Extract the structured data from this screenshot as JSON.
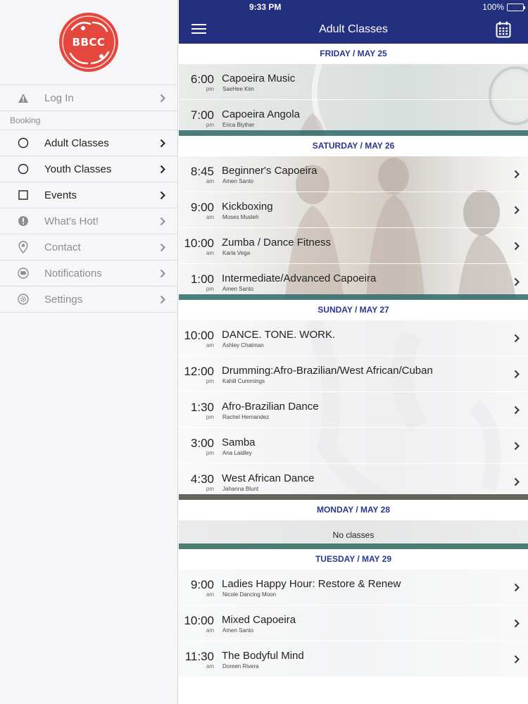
{
  "status_bar": {
    "time": "9:33 PM",
    "battery": "100%"
  },
  "nav": {
    "title": "Adult Classes"
  },
  "logo": {
    "text": "BBCC"
  },
  "sidebar": {
    "login": {
      "label": "Log In"
    },
    "section_label": "Booking",
    "items": [
      {
        "label": "Adult Classes"
      },
      {
        "label": "Youth Classes"
      },
      {
        "label": "Events"
      },
      {
        "label": "What's Hot!"
      },
      {
        "label": "Contact"
      },
      {
        "label": "Notifications"
      },
      {
        "label": "Settings"
      }
    ]
  },
  "days": [
    {
      "header": "FRIDAY / MAY 25",
      "classes": [
        {
          "time": "6:00",
          "ampm": "pm",
          "name": "Capoeira Music",
          "instructor": "SaeHee Kim"
        },
        {
          "time": "7:00",
          "ampm": "pm",
          "name": "Capoeira Angola",
          "instructor": "Erica Blyther"
        }
      ]
    },
    {
      "header": "SATURDAY / MAY 26",
      "classes": [
        {
          "time": "8:45",
          "ampm": "am",
          "name": "Beginner's Capoeira",
          "instructor": "Amen Santo"
        },
        {
          "time": "9:00",
          "ampm": "am",
          "name": "Kickboxing",
          "instructor": "Moses Musleh"
        },
        {
          "time": "10:00",
          "ampm": "am",
          "name": "Zumba / Dance Fitness",
          "instructor": "Karla Vega"
        },
        {
          "time": "1:00",
          "ampm": "pm",
          "name": "Intermediate/Advanced Capoeira",
          "instructor": "Amen Santo"
        }
      ]
    },
    {
      "header": "SUNDAY / MAY 27",
      "classes": [
        {
          "time": "10:00",
          "ampm": "am",
          "name": "DANCE. TONE. WORK.",
          "instructor": "Ashley Chatman"
        },
        {
          "time": "12:00",
          "ampm": "pm",
          "name": "Drumming:Afro-Brazilian/West African/Cuban",
          "instructor": "Kahill Cummings"
        },
        {
          "time": "1:30",
          "ampm": "pm",
          "name": "Afro-Brazilian Dance",
          "instructor": "Rachel Hernandez"
        },
        {
          "time": "3:00",
          "ampm": "pm",
          "name": "Samba",
          "instructor": "Ana Laidley"
        },
        {
          "time": "4:30",
          "ampm": "pm",
          "name": "West African Dance",
          "instructor": "Jahanna Blunt"
        }
      ]
    },
    {
      "header": "MONDAY / MAY 28",
      "no_classes": "No classes"
    },
    {
      "header": "TUESDAY / MAY 29",
      "classes": [
        {
          "time": "9:00",
          "ampm": "am",
          "name": "Ladies Happy Hour: Restore & Renew",
          "instructor": "Nicole Dancing Moon"
        },
        {
          "time": "10:00",
          "ampm": "am",
          "name": "Mixed Capoeira",
          "instructor": "Amen Santo"
        },
        {
          "time": "11:30",
          "ampm": "am",
          "name": "The Bodyful Mind",
          "instructor": "Doreen Rivera"
        }
      ]
    }
  ],
  "colors": {
    "nav_bar": "#23307f",
    "day_header_text": "#2a3791",
    "logo": "#e4473d"
  },
  "icons": {
    "menu": "hamburger-icon",
    "calendar": "calendar-icon",
    "login": "warning-icon",
    "adult": "circle-icon",
    "youth": "circle-icon",
    "events": "square-icon",
    "hot": "exclamation-icon",
    "contact": "location-pin-icon",
    "notifications": "chat-bubble-icon",
    "settings": "gear-icon",
    "chevron": "chevron-right-icon"
  }
}
